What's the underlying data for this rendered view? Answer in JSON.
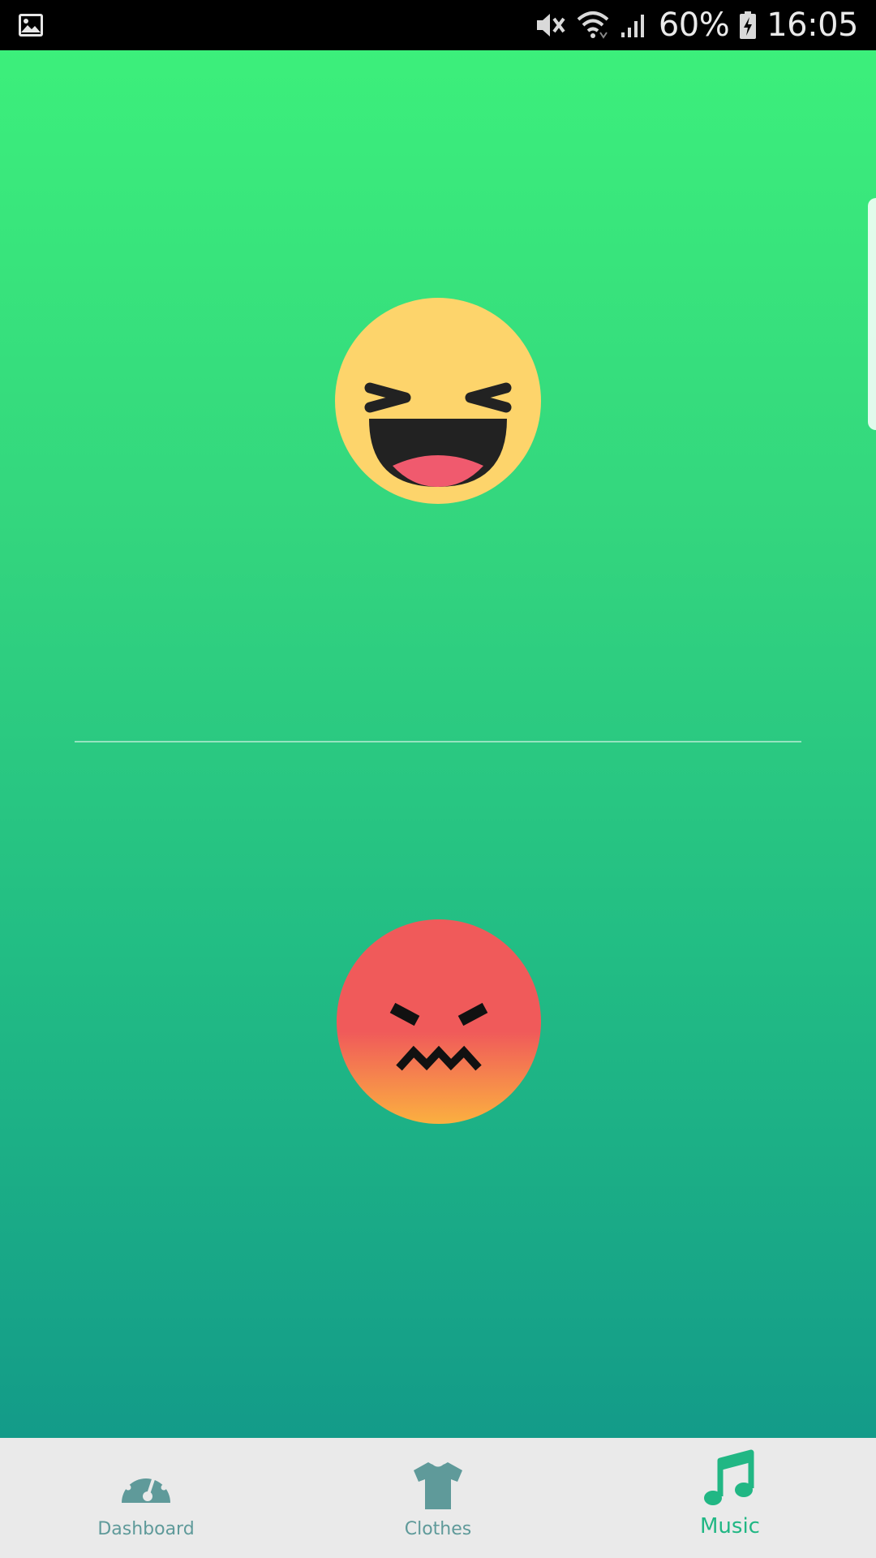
{
  "status_bar": {
    "battery_percent": "60%",
    "time": "16:05",
    "icons": [
      "gallery-notification-icon",
      "mute-icon",
      "wifi-icon",
      "signal-icon",
      "battery-charging-icon"
    ]
  },
  "main": {
    "top_emoji": "laughing-emoji-icon",
    "bottom_emoji": "angry-emoji-icon"
  },
  "bottom_nav": {
    "items": [
      {
        "label": "Dashboard",
        "icon": "dashboard-gauge-icon",
        "active": false
      },
      {
        "label": "Clothes",
        "icon": "tshirt-icon",
        "active": false
      },
      {
        "label": "Music",
        "icon": "music-note-icon",
        "active": true
      }
    ]
  },
  "colors": {
    "gradient_top": "#3cef7b",
    "gradient_bottom": "#139b89",
    "nav_inactive": "#5f9a9a",
    "nav_active": "#21b784",
    "nav_background": "#eaeaea"
  }
}
